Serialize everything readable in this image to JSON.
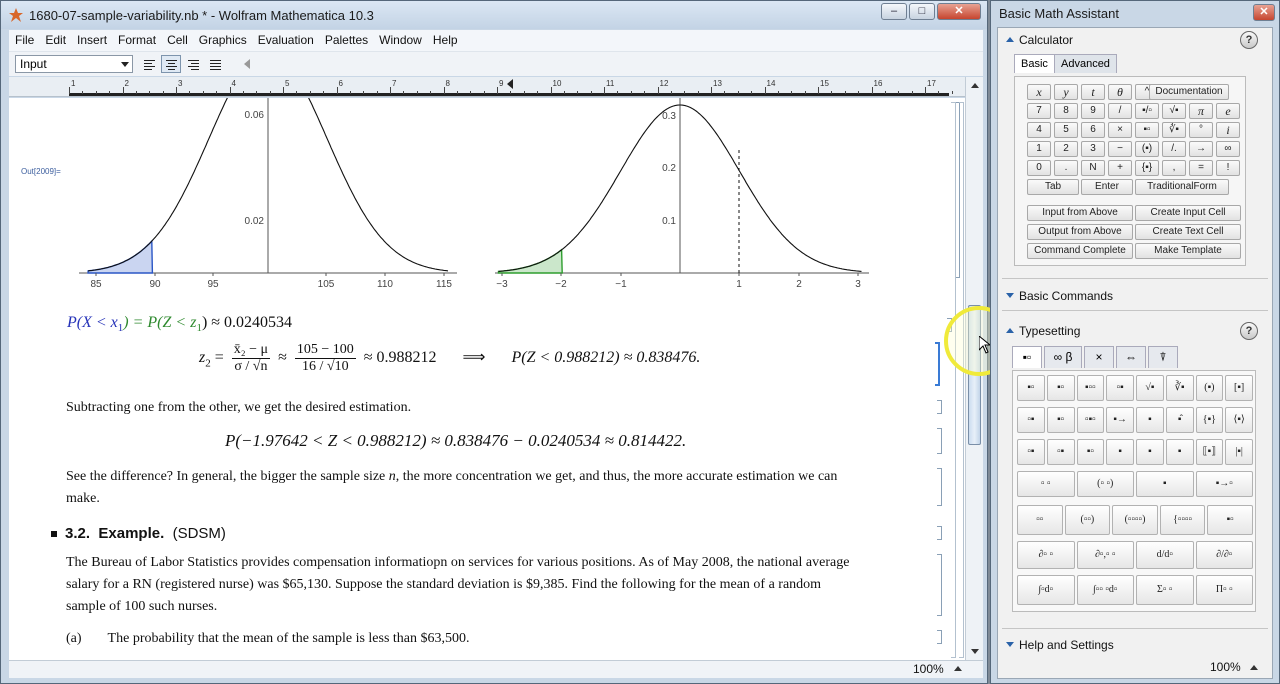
{
  "window": {
    "title": "1680-07-sample-variability.nb * - Wolfram Mathematica 10.3",
    "controls": {
      "minimize": "‒",
      "maximize": "□",
      "close": "✕"
    }
  },
  "menu": [
    "File",
    "Edit",
    "Insert",
    "Format",
    "Cell",
    "Graphics",
    "Evaluation",
    "Palettes",
    "Window",
    "Help"
  ],
  "toolbar": {
    "style_value": "Input"
  },
  "ruler": {
    "numbers": [
      "1",
      "2",
      "3",
      "4",
      "5",
      "6",
      "7",
      "8",
      "9",
      "10",
      "11",
      "12",
      "13",
      "14",
      "15",
      "16",
      "17"
    ]
  },
  "output_label": "Out[2009]=",
  "plot1": {
    "x_ticks": [
      "85",
      "90",
      "95",
      "105",
      "110",
      "115"
    ],
    "y_ticks": [
      "0.06",
      "0.02"
    ],
    "shade_color": "#2a56c6"
  },
  "plot2": {
    "x_ticks": [
      "−3",
      "−2",
      "−1",
      "1",
      "2",
      "3"
    ],
    "y_ticks": [
      "0.3",
      "0.2",
      "0.1"
    ],
    "shade_color": "#2e9e2e"
  },
  "formula1": {
    "lhs": "P(X < x",
    "sub": "1",
    "mid": ") = P(Z < z",
    "sub2": "1",
    "rhs": ") ≈ 0.0240534"
  },
  "formula2": {
    "z": "z",
    "zsub": "2",
    "eq": "=",
    "num1": "x̄₂ − μ",
    "den1": "σ / √n",
    "approx": "≈",
    "num2": "105 − 100",
    "den2": "16 / √10",
    "val": "≈ 0.988212",
    "implies": "⟹",
    "result": "P(Z < 0.988212) ≈ 0.838476."
  },
  "text1": "Subtracting one from the other, we get the desired estimation.",
  "formula3": "P(−1.97642 < Z < 0.988212) ≈ 0.838476 − 0.0240534 ≈ 0.814422.",
  "text2": {
    "line1a": "See the difference?  In general, the bigger the sample size",
    "n": "n",
    "line1b": ",  the more concentration we get, and thus, the more accurate estimation we can",
    "line2": "make."
  },
  "section": {
    "number": "3.2.",
    "title": "Example.",
    "tag": "(SDSM)"
  },
  "paragraph": [
    "The Bureau of Labor Statistics provides compensation informatiopn on services for various positions.  As of May 2008, the national average",
    "salary for a RN (registered nurse) was $65,130.  Suppose the standard deviation is $9,385.  Find the following for the mean of a random",
    "sample of 100 such nurses."
  ],
  "item_a": {
    "label": "(a)",
    "text": "The probability that the mean of the sample is less than $63,500."
  },
  "status": {
    "zoom": "100%"
  },
  "palette": {
    "title": "Basic Math Assistant",
    "close": "✕",
    "calculator": {
      "header": "Calculator",
      "help": "?",
      "tabs": [
        "Basic",
        "Advanced"
      ],
      "keys": [
        [
          "x",
          "y",
          "t",
          "θ",
          "^",
          "Documentation"
        ],
        [
          "7",
          "8",
          "9",
          "/",
          "▪/▫",
          "√▪",
          "π",
          "e"
        ],
        [
          "4",
          "5",
          "6",
          "×",
          "▪▫",
          "∛▪",
          "°",
          "i"
        ],
        [
          "1",
          "2",
          "3",
          "−",
          "(▪)",
          "/.",
          "→",
          "∞"
        ],
        [
          "0",
          ".",
          "N",
          "+",
          "{▪}",
          ",",
          "=",
          "!"
        ],
        [
          "Tab",
          "Enter",
          "TraditionalForm"
        ]
      ],
      "actions": [
        "Input from Above",
        "Create Input Cell",
        "Output from Above",
        "Create Text Cell",
        "Command Complete",
        "Make Template"
      ]
    },
    "basic_commands": "Basic Commands",
    "typesetting": {
      "header": "Typesetting",
      "help": "?",
      "tabs": [
        "▪▫",
        "∞ β",
        "×",
        "⇔",
        "⍒"
      ],
      "rows": [
        [
          "▪▫",
          "▪▫",
          "▪▫▫",
          "▫▪",
          "√▪",
          "∛▪",
          "(▪)",
          "[▪]"
        ],
        [
          "▫▪",
          "▪▫",
          "▫▪▫",
          "▪→",
          "▪",
          "▪̂",
          "{▪}",
          "⟨▪⟩"
        ],
        [
          "▫▪",
          "▫▪",
          "▪▫",
          "▪",
          "▪",
          "▪",
          "⟦▪⟧",
          "|▪|"
        ],
        [
          "▫ ▫",
          "(▫ ▫)",
          "▪",
          "▪→▫"
        ],
        [
          "▫▫",
          "(▫▫)",
          "(▫▫▫▫)",
          "{▫▫▫▫",
          "▪▫"
        ],
        [
          "∂▫ ▫",
          "∂▫,▫ ▫",
          "d/d▫",
          "∂/∂▫"
        ],
        [
          "∫▫d▫",
          "∫▫▫ ▫d▫",
          "Σ▫ ▫",
          "Π▫ ▫"
        ]
      ]
    },
    "help_settings": "Help and Settings",
    "zoom": "100%"
  }
}
